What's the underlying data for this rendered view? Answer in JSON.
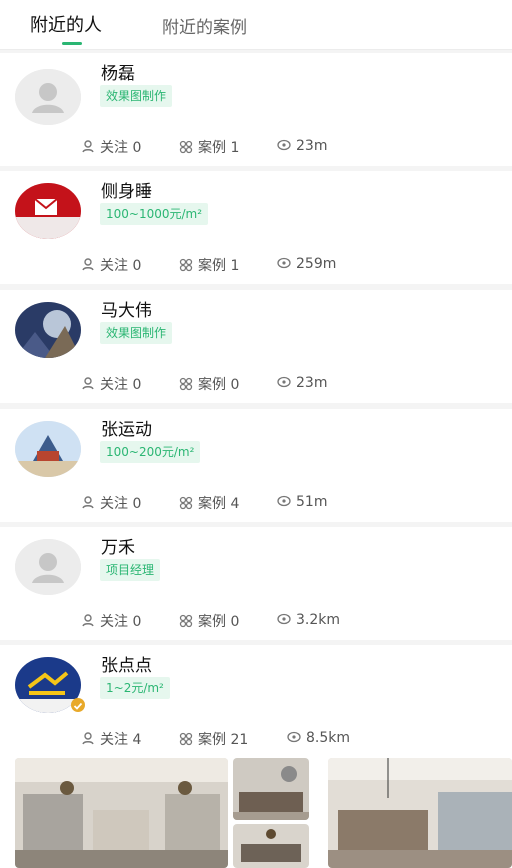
{
  "tabs": {
    "active": "附近的人",
    "inactive": "附近的案例"
  },
  "people": [
    {
      "name": "杨磊",
      "tag": "效果图制作",
      "follow": "关注 0",
      "cases": "案例 1",
      "distance": "23m"
    },
    {
      "name": "侧身睡",
      "tag": "100~1000元/m²",
      "follow": "关注 0",
      "cases": "案例 1",
      "distance": "259m"
    },
    {
      "name": "马大伟",
      "tag": "效果图制作",
      "follow": "关注 0",
      "cases": "案例 0",
      "distance": "23m"
    },
    {
      "name": "张运动",
      "tag": "100~200元/m²",
      "follow": "关注 0",
      "cases": "案例 4",
      "distance": "51m"
    },
    {
      "name": "万禾",
      "tag": "项目经理",
      "follow": "关注 0",
      "cases": "案例 0",
      "distance": "3.2km"
    },
    {
      "name": "张点点",
      "tag": "1~2元/m²",
      "follow": "关注 4",
      "cases": "案例 21",
      "distance": "8.5km"
    }
  ],
  "icons": [
    "user-icon",
    "grid-icon",
    "location-icon",
    "verified-badge-icon"
  ],
  "colors": {
    "accent": "#2bb673",
    "tag_bg": "#e6f7ee"
  }
}
